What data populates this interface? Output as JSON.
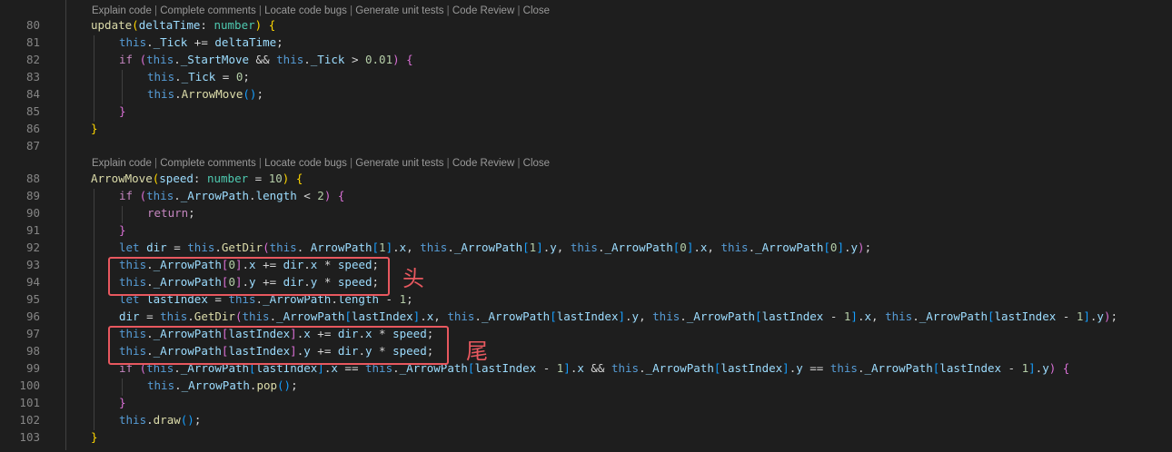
{
  "codelens": {
    "items": [
      "Explain code",
      "Complete comments",
      "Locate code bugs",
      "Generate unit tests",
      "Code Review",
      "Close"
    ],
    "separator": " | "
  },
  "annotations": {
    "head": "头",
    "tail": "尾"
  },
  "colors": {
    "background": "#1e1e1e",
    "line_number": "#858585",
    "keyword_control": "#c586c0",
    "keyword": "#569cd6",
    "function": "#dcdcaa",
    "variable": "#9cdcfe",
    "type": "#4ec9b0",
    "number": "#b5cea8",
    "bracket_gold": "#ffd700",
    "bracket_purple": "#da70d6",
    "bracket_blue": "#179fff",
    "highlight_box": "#e8585f"
  },
  "lines": [
    {
      "n": "80",
      "indent": 1,
      "tokens": [
        [
          "update",
          "fn"
        ],
        [
          "(",
          "b1"
        ],
        [
          "deltaTime",
          "param"
        ],
        [
          ": ",
          "p"
        ],
        [
          "number",
          "type"
        ],
        [
          ") ",
          "b1"
        ],
        [
          "{",
          "b1"
        ]
      ]
    },
    {
      "n": "81",
      "indent": 2,
      "tokens": [
        [
          "this",
          "kw"
        ],
        [
          ".",
          "p"
        ],
        [
          "_Tick",
          "var"
        ],
        [
          " += ",
          "p"
        ],
        [
          "deltaTime",
          "var"
        ],
        [
          ";",
          "p"
        ]
      ]
    },
    {
      "n": "82",
      "indent": 2,
      "tokens": [
        [
          "if",
          "ctl"
        ],
        [
          " ",
          "p"
        ],
        [
          "(",
          "b2"
        ],
        [
          "this",
          "kw"
        ],
        [
          ".",
          "p"
        ],
        [
          "_StartMove",
          "var"
        ],
        [
          " && ",
          "p"
        ],
        [
          "this",
          "kw"
        ],
        [
          ".",
          "p"
        ],
        [
          "_Tick",
          "var"
        ],
        [
          " > ",
          "p"
        ],
        [
          "0.01",
          "num"
        ],
        [
          ")",
          "b2"
        ],
        [
          " ",
          "p"
        ],
        [
          "{",
          "b2"
        ]
      ]
    },
    {
      "n": "83",
      "indent": 3,
      "tokens": [
        [
          "this",
          "kw"
        ],
        [
          ".",
          "p"
        ],
        [
          "_Tick",
          "var"
        ],
        [
          " = ",
          "p"
        ],
        [
          "0",
          "num"
        ],
        [
          ";",
          "p"
        ]
      ]
    },
    {
      "n": "84",
      "indent": 3,
      "tokens": [
        [
          "this",
          "kw"
        ],
        [
          ".",
          "p"
        ],
        [
          "ArrowMove",
          "fn"
        ],
        [
          "()",
          "b3"
        ],
        [
          ";",
          "p"
        ]
      ]
    },
    {
      "n": "85",
      "indent": 2,
      "tokens": [
        [
          "}",
          "b2"
        ]
      ]
    },
    {
      "n": "86",
      "indent": 1,
      "tokens": [
        [
          "}",
          "b1"
        ]
      ]
    },
    {
      "n": "87",
      "indent": 0,
      "tokens": []
    },
    {
      "n": "88",
      "indent": 1,
      "tokens": [
        [
          "ArrowMove",
          "fn"
        ],
        [
          "(",
          "b1"
        ],
        [
          "speed",
          "param"
        ],
        [
          ": ",
          "p"
        ],
        [
          "number",
          "type"
        ],
        [
          " = ",
          "p"
        ],
        [
          "10",
          "num"
        ],
        [
          ") ",
          "b1"
        ],
        [
          "{",
          "b1"
        ]
      ]
    },
    {
      "n": "89",
      "indent": 2,
      "tokens": [
        [
          "if",
          "ctl"
        ],
        [
          " ",
          "p"
        ],
        [
          "(",
          "b2"
        ],
        [
          "this",
          "kw"
        ],
        [
          ".",
          "p"
        ],
        [
          "_ArrowPath",
          "var"
        ],
        [
          ".",
          "p"
        ],
        [
          "length",
          "var"
        ],
        [
          " < ",
          "p"
        ],
        [
          "2",
          "num"
        ],
        [
          ")",
          "b2"
        ],
        [
          " ",
          "p"
        ],
        [
          "{",
          "b2"
        ]
      ]
    },
    {
      "n": "90",
      "indent": 3,
      "tokens": [
        [
          "return",
          "ctl"
        ],
        [
          ";",
          "p"
        ]
      ]
    },
    {
      "n": "91",
      "indent": 2,
      "tokens": [
        [
          "}",
          "b2"
        ]
      ]
    },
    {
      "n": "92",
      "indent": 2,
      "tokens": [
        [
          "let",
          "kw"
        ],
        [
          " ",
          "p"
        ],
        [
          "dir",
          "var"
        ],
        [
          " = ",
          "p"
        ],
        [
          "this",
          "kw"
        ],
        [
          ".",
          "p"
        ],
        [
          "GetDir",
          "fn"
        ],
        [
          "(",
          "b2"
        ],
        [
          "this",
          "kw"
        ],
        [
          ". ",
          "p"
        ],
        [
          "ArrowPath",
          "var"
        ],
        [
          "[",
          "b3"
        ],
        [
          "1",
          "num"
        ],
        [
          "]",
          "b3"
        ],
        [
          ".",
          "p"
        ],
        [
          "x",
          "var"
        ],
        [
          ", ",
          "p"
        ],
        [
          "this",
          "kw"
        ],
        [
          ".",
          "p"
        ],
        [
          "_ArrowPath",
          "var"
        ],
        [
          "[",
          "b3"
        ],
        [
          "1",
          "num"
        ],
        [
          "]",
          "b3"
        ],
        [
          ".",
          "p"
        ],
        [
          "y",
          "var"
        ],
        [
          ", ",
          "p"
        ],
        [
          "this",
          "kw"
        ],
        [
          ".",
          "p"
        ],
        [
          "_ArrowPath",
          "var"
        ],
        [
          "[",
          "b3"
        ],
        [
          "0",
          "num"
        ],
        [
          "]",
          "b3"
        ],
        [
          ".",
          "p"
        ],
        [
          "x",
          "var"
        ],
        [
          ", ",
          "p"
        ],
        [
          "this",
          "kw"
        ],
        [
          ".",
          "p"
        ],
        [
          "_ArrowPath",
          "var"
        ],
        [
          "[",
          "b3"
        ],
        [
          "0",
          "num"
        ],
        [
          "]",
          "b3"
        ],
        [
          ".",
          "p"
        ],
        [
          "y",
          "var"
        ],
        [
          ")",
          "b2"
        ],
        [
          ";",
          "p"
        ]
      ]
    },
    {
      "n": "93",
      "indent": 2,
      "tokens": [
        [
          "this",
          "kw"
        ],
        [
          ".",
          "p"
        ],
        [
          "_ArrowPath",
          "var"
        ],
        [
          "[",
          "b2"
        ],
        [
          "0",
          "num"
        ],
        [
          "]",
          "b2"
        ],
        [
          ".",
          "p"
        ],
        [
          "x",
          "var"
        ],
        [
          " += ",
          "p"
        ],
        [
          "dir",
          "var"
        ],
        [
          ".",
          "p"
        ],
        [
          "x",
          "var"
        ],
        [
          " * ",
          "p"
        ],
        [
          "speed",
          "var"
        ],
        [
          ";",
          "p"
        ]
      ]
    },
    {
      "n": "94",
      "indent": 2,
      "tokens": [
        [
          "this",
          "kw"
        ],
        [
          ".",
          "p"
        ],
        [
          "_ArrowPath",
          "var"
        ],
        [
          "[",
          "b2"
        ],
        [
          "0",
          "num"
        ],
        [
          "]",
          "b2"
        ],
        [
          ".",
          "p"
        ],
        [
          "y",
          "var"
        ],
        [
          " += ",
          "p"
        ],
        [
          "dir",
          "var"
        ],
        [
          ".",
          "p"
        ],
        [
          "y",
          "var"
        ],
        [
          " * ",
          "p"
        ],
        [
          "speed",
          "var"
        ],
        [
          ";",
          "p"
        ]
      ]
    },
    {
      "n": "95",
      "indent": 2,
      "tokens": [
        [
          "let",
          "kw"
        ],
        [
          " ",
          "p"
        ],
        [
          "lastIndex",
          "var"
        ],
        [
          " = ",
          "p"
        ],
        [
          "this",
          "kw"
        ],
        [
          ".",
          "p"
        ],
        [
          "_ArrowPath",
          "var"
        ],
        [
          ".",
          "p"
        ],
        [
          "length",
          "var"
        ],
        [
          " - ",
          "p"
        ],
        [
          "1",
          "num"
        ],
        [
          ";",
          "p"
        ]
      ]
    },
    {
      "n": "96",
      "indent": 2,
      "tokens": [
        [
          "dir",
          "var"
        ],
        [
          " = ",
          "p"
        ],
        [
          "this",
          "kw"
        ],
        [
          ".",
          "p"
        ],
        [
          "GetDir",
          "fn"
        ],
        [
          "(",
          "b2"
        ],
        [
          "this",
          "kw"
        ],
        [
          ".",
          "p"
        ],
        [
          "_ArrowPath",
          "var"
        ],
        [
          "[",
          "b3"
        ],
        [
          "lastIndex",
          "var"
        ],
        [
          "]",
          "b3"
        ],
        [
          ".",
          "p"
        ],
        [
          "x",
          "var"
        ],
        [
          ", ",
          "p"
        ],
        [
          "this",
          "kw"
        ],
        [
          ".",
          "p"
        ],
        [
          "_ArrowPath",
          "var"
        ],
        [
          "[",
          "b3"
        ],
        [
          "lastIndex",
          "var"
        ],
        [
          "]",
          "b3"
        ],
        [
          ".",
          "p"
        ],
        [
          "y",
          "var"
        ],
        [
          ", ",
          "p"
        ],
        [
          "this",
          "kw"
        ],
        [
          ".",
          "p"
        ],
        [
          "_ArrowPath",
          "var"
        ],
        [
          "[",
          "b3"
        ],
        [
          "lastIndex",
          "var"
        ],
        [
          " - ",
          "p"
        ],
        [
          "1",
          "num"
        ],
        [
          "]",
          "b3"
        ],
        [
          ".",
          "p"
        ],
        [
          "x",
          "var"
        ],
        [
          ", ",
          "p"
        ],
        [
          "this",
          "kw"
        ],
        [
          ".",
          "p"
        ],
        [
          "_ArrowPath",
          "var"
        ],
        [
          "[",
          "b3"
        ],
        [
          "lastIndex",
          "var"
        ],
        [
          " - ",
          "p"
        ],
        [
          "1",
          "num"
        ],
        [
          "]",
          "b3"
        ],
        [
          ".",
          "p"
        ],
        [
          "y",
          "var"
        ],
        [
          ")",
          "b2"
        ],
        [
          ";",
          "p"
        ]
      ]
    },
    {
      "n": "97",
      "indent": 2,
      "tokens": [
        [
          "this",
          "kw"
        ],
        [
          ".",
          "p"
        ],
        [
          "_ArrowPath",
          "var"
        ],
        [
          "[",
          "b2"
        ],
        [
          "lastIndex",
          "var"
        ],
        [
          "]",
          "b2"
        ],
        [
          ".",
          "p"
        ],
        [
          "x",
          "var"
        ],
        [
          " += ",
          "p"
        ],
        [
          "dir",
          "var"
        ],
        [
          ".",
          "p"
        ],
        [
          "x",
          "var"
        ],
        [
          " * ",
          "p"
        ],
        [
          "speed",
          "var"
        ],
        [
          ";",
          "p"
        ]
      ]
    },
    {
      "n": "98",
      "indent": 2,
      "tokens": [
        [
          "this",
          "kw"
        ],
        [
          ".",
          "p"
        ],
        [
          "_ArrowPath",
          "var"
        ],
        [
          "[",
          "b2"
        ],
        [
          "lastIndex",
          "var"
        ],
        [
          "]",
          "b2"
        ],
        [
          ".",
          "p"
        ],
        [
          "y",
          "var"
        ],
        [
          " += ",
          "p"
        ],
        [
          "dir",
          "var"
        ],
        [
          ".",
          "p"
        ],
        [
          "y",
          "var"
        ],
        [
          " * ",
          "p"
        ],
        [
          "speed",
          "var"
        ],
        [
          ";",
          "p"
        ]
      ]
    },
    {
      "n": "99",
      "indent": 2,
      "tokens": [
        [
          "if",
          "ctl"
        ],
        [
          " ",
          "p"
        ],
        [
          "(",
          "b2"
        ],
        [
          "this",
          "kw"
        ],
        [
          ".",
          "p"
        ],
        [
          "_ArrowPath",
          "var"
        ],
        [
          "[",
          "b3"
        ],
        [
          "lastIndex",
          "var"
        ],
        [
          "]",
          "b3"
        ],
        [
          ".",
          "p"
        ],
        [
          "x",
          "var"
        ],
        [
          " == ",
          "p"
        ],
        [
          "this",
          "kw"
        ],
        [
          ".",
          "p"
        ],
        [
          "_ArrowPath",
          "var"
        ],
        [
          "[",
          "b3"
        ],
        [
          "lastIndex",
          "var"
        ],
        [
          " - ",
          "p"
        ],
        [
          "1",
          "num"
        ],
        [
          "]",
          "b3"
        ],
        [
          ".",
          "p"
        ],
        [
          "x",
          "var"
        ],
        [
          " && ",
          "p"
        ],
        [
          "this",
          "kw"
        ],
        [
          ".",
          "p"
        ],
        [
          "_ArrowPath",
          "var"
        ],
        [
          "[",
          "b3"
        ],
        [
          "lastIndex",
          "var"
        ],
        [
          "]",
          "b3"
        ],
        [
          ".",
          "p"
        ],
        [
          "y",
          "var"
        ],
        [
          " == ",
          "p"
        ],
        [
          "this",
          "kw"
        ],
        [
          ".",
          "p"
        ],
        [
          "_ArrowPath",
          "var"
        ],
        [
          "[",
          "b3"
        ],
        [
          "lastIndex",
          "var"
        ],
        [
          " - ",
          "p"
        ],
        [
          "1",
          "num"
        ],
        [
          "]",
          "b3"
        ],
        [
          ".",
          "p"
        ],
        [
          "y",
          "var"
        ],
        [
          ")",
          "b2"
        ],
        [
          " ",
          "p"
        ],
        [
          "{",
          "b2"
        ]
      ]
    },
    {
      "n": "100",
      "indent": 3,
      "tokens": [
        [
          "this",
          "kw"
        ],
        [
          ".",
          "p"
        ],
        [
          "_ArrowPath",
          "var"
        ],
        [
          ".",
          "p"
        ],
        [
          "pop",
          "fn"
        ],
        [
          "()",
          "b3"
        ],
        [
          ";",
          "p"
        ]
      ]
    },
    {
      "n": "101",
      "indent": 2,
      "tokens": [
        [
          "}",
          "b2"
        ]
      ]
    },
    {
      "n": "102",
      "indent": 2,
      "tokens": [
        [
          "this",
          "kw"
        ],
        [
          ".",
          "p"
        ],
        [
          "draw",
          "fn"
        ],
        [
          "()",
          "b3"
        ],
        [
          ";",
          "p"
        ]
      ]
    },
    {
      "n": "103",
      "indent": 1,
      "tokens": [
        [
          "}",
          "b1"
        ]
      ]
    }
  ]
}
